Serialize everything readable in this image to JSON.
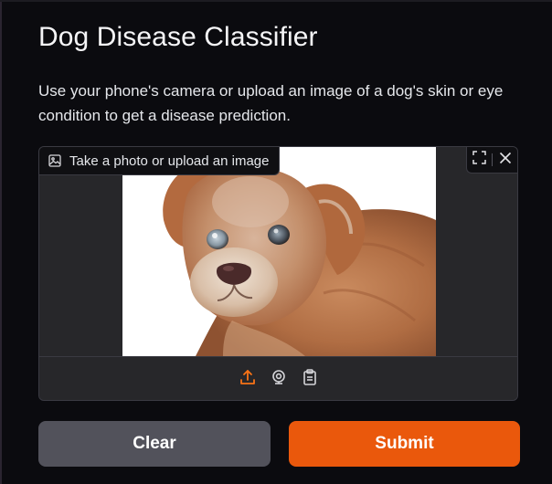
{
  "app": {
    "title": "Dog Disease Classifier",
    "description": "Use your phone's camera or upload an image of a dog's skin or eye condition to get a disease prediction."
  },
  "image_input": {
    "label": "Take a photo or upload an image",
    "label_icon": "image-icon",
    "controls": [
      "fullscreen-icon",
      "close-icon"
    ],
    "toolbar": [
      {
        "icon": "upload-icon",
        "active": true
      },
      {
        "icon": "webcam-icon",
        "active": false
      },
      {
        "icon": "clipboard-icon",
        "active": false
      }
    ],
    "preview_subject": "dog-photo"
  },
  "actions": {
    "clear_label": "Clear",
    "submit_label": "Submit"
  },
  "colors": {
    "background": "#0b0b0f",
    "panel": "#27272a",
    "accent": "#ea580c",
    "secondary_button": "#52525b",
    "text": "#f3f4f6"
  }
}
